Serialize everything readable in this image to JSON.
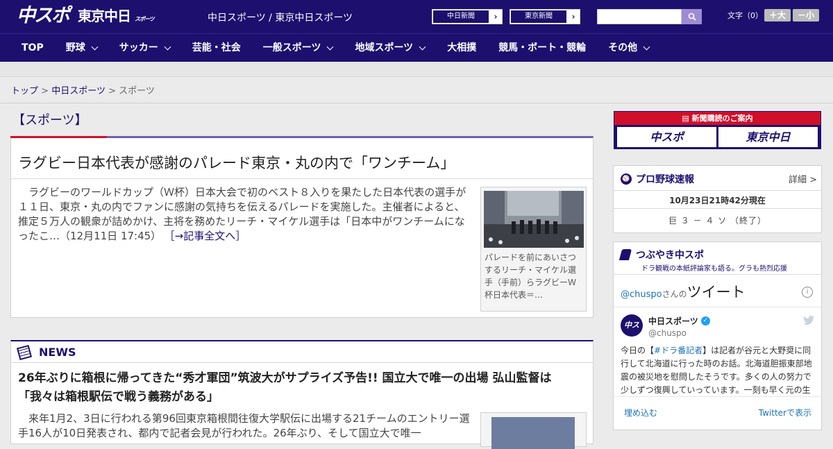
{
  "header": {
    "logo_chuspo": "中スポ",
    "logo_tokyo": "東京中日",
    "logo_tokyo_sub": "スポーツ",
    "site_title": "中日スポーツ / 東京中日スポーツ",
    "btn_chunichi": "中日新聞",
    "btn_tokyo": "東京新聞",
    "arrow": "›",
    "search_placeholder": "",
    "font_size_label": "文字（0）",
    "font_up": "＋大",
    "font_down": "－小"
  },
  "nav": {
    "items": [
      "TOP",
      "野球",
      "サッカー",
      "芸能・社会",
      "一般スポーツ",
      "地域スポーツ",
      "大相撲",
      "競馬・ボート・競輪",
      "その他"
    ]
  },
  "breadcrumb": {
    "top": "トップ",
    "sep": ">",
    "chunichi": "中日スポーツ",
    "current": "スポーツ"
  },
  "main": {
    "section_title": "【スポーツ】",
    "article1": {
      "headline": "ラグビー日本代表が感謝のパレード東京・丸の内で「ワンチーム」",
      "body": "ラグビーのワールドカップ（Ｗ杯）日本大会で初のベスト８入りを果たした日本代表の選手が１１日、東京・丸の内でファンに感謝の気持ちを伝えるパレードを実施した。主催者によると、推定５万人の観衆が詰めかけ、主将を務めたリーチ・マイケル選手は「日本中がワンチームになったこ…（12月11日 17:45）",
      "more": "［→記事全文へ］",
      "caption": "パレードを前にあいさつするリーチ・マイケル選手（手前）らラグビーＷ杯日本代表＝…"
    },
    "news": {
      "label": "NEWS",
      "headline": "26年ぶりに箱根に帰ってきた“秀才軍団”筑波大がサプライズ予告!! 国立大で唯一の出場 弘山監督は「我々は箱根駅伝で戦う義務がある」",
      "body": "来年1月2、3日に行われる第96回東京箱根間往復大学駅伝に出場する21チームのエントリー選手16人が10日発表され、都内で記者会見が行われた。26年ぶり、そして国立大で唯一"
    }
  },
  "sidebar": {
    "subscribe_title": "新聞購読のご案内",
    "sub_logo1": "中スポ",
    "sub_logo2": "東京中日",
    "baseball": {
      "title": "プロ野球速報",
      "detail": "詳細 >",
      "time": "10月23日21時42分現在",
      "score": "巨 ３ － ４ ソ （終了）"
    },
    "tweets": {
      "title": "つぶやき中スポ",
      "subtitle": "ドラ観戦の本紙評論家も語る。グラも熱烈応援",
      "handle": "@chuspo",
      "san": "さんの",
      "tweet_word": "ツイート",
      "name": "中日スポーツ",
      "screen_name": "@chuspo",
      "text_pre": "今日の【",
      "text_tag": "#ドラ番記者",
      "text_post": "】は記者が谷元と大野奨に同行して北海道に行った時のお話。北海道胆振東部地震の被災地を慰問したそうです。多くの人の努力で少しずつ復興していっています。一刻も早く元の生",
      "embed": "埋め込む",
      "view": "Twitterで表示"
    }
  },
  "colors": {
    "brand_navy": "#1c0f6e",
    "accent_red": "#d0102a",
    "link_blue": "#1b73b4"
  }
}
